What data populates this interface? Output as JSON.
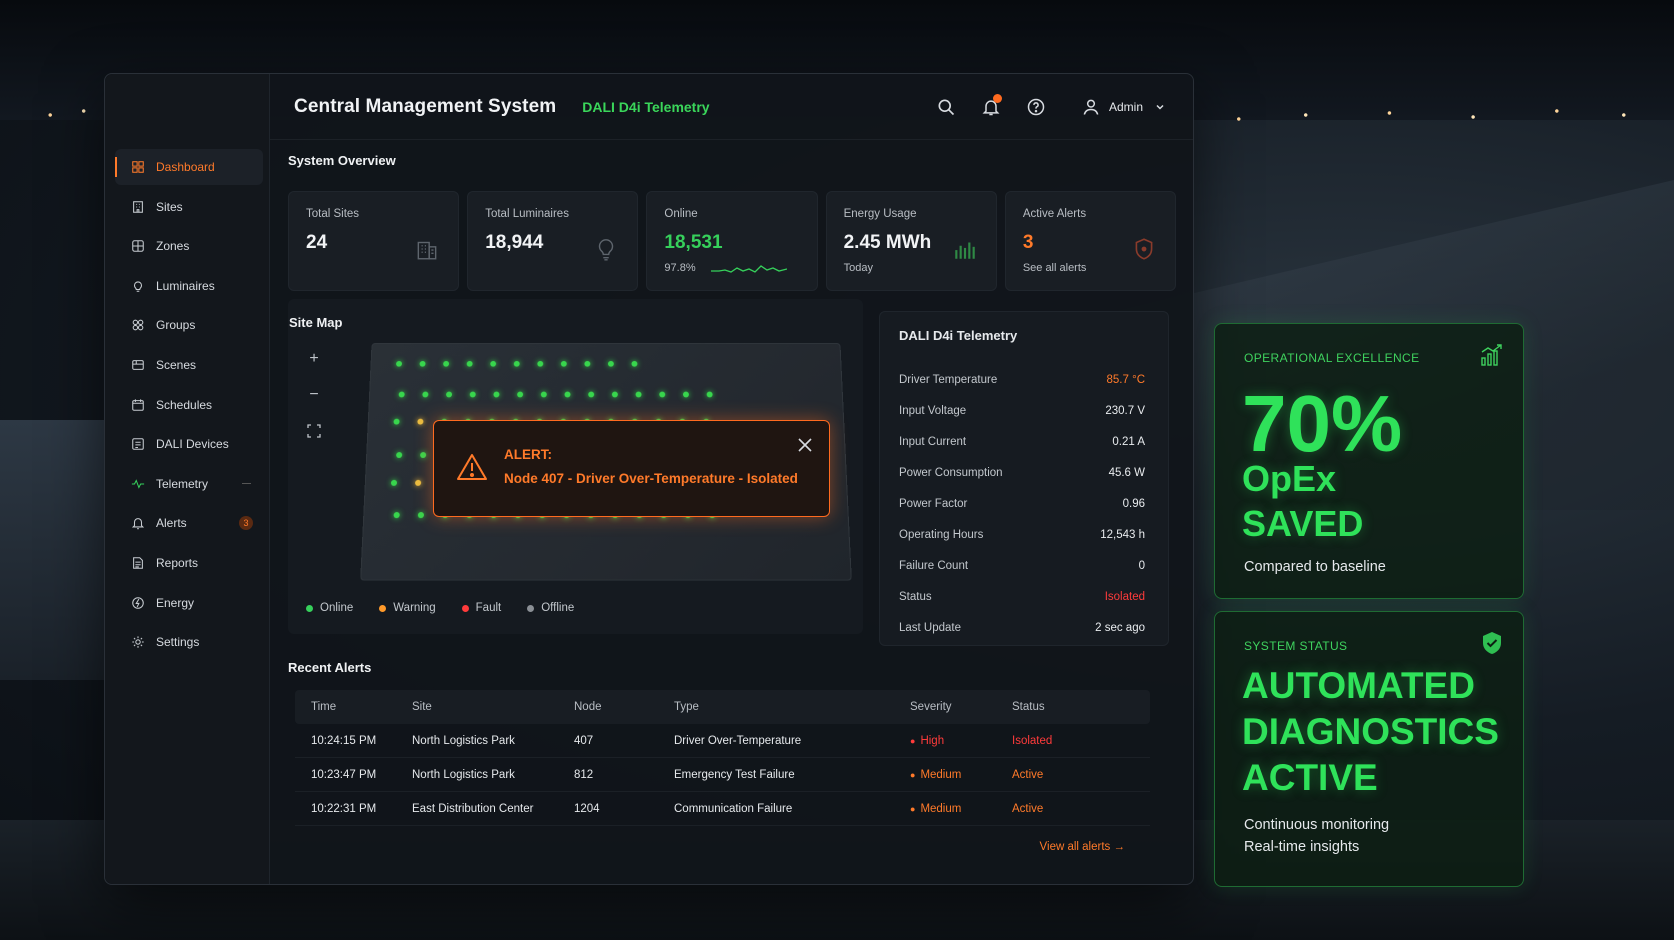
{
  "app": {
    "title": "Central Management System",
    "subtitle": "DALI D4i Telemetry"
  },
  "topbar": {
    "user": "Admin",
    "notifications": 1
  },
  "sidebar": {
    "items": [
      {
        "label": "Dashboard",
        "icon": "dashboard-icon",
        "active": true
      },
      {
        "label": "Sites",
        "icon": "building-icon"
      },
      {
        "label": "Zones",
        "icon": "zones-icon"
      },
      {
        "label": "Luminaires",
        "icon": "bulb-icon"
      },
      {
        "label": "Groups",
        "icon": "groups-icon"
      },
      {
        "label": "Scenes",
        "icon": "scenes-icon"
      },
      {
        "label": "Schedules",
        "icon": "calendar-icon"
      },
      {
        "label": "DALI Devices",
        "icon": "device-icon"
      },
      {
        "label": "Telemetry",
        "icon": "pulse-icon"
      },
      {
        "label": "Alerts",
        "icon": "bell-icon",
        "badge": "3"
      },
      {
        "label": "Reports",
        "icon": "report-icon"
      },
      {
        "label": "Energy",
        "icon": "energy-icon"
      },
      {
        "label": "Settings",
        "icon": "gear-icon"
      }
    ]
  },
  "overview": {
    "title": "System Overview",
    "cards": [
      {
        "label": "Total Sites",
        "value": "24",
        "sub": ""
      },
      {
        "label": "Total Luminaires",
        "value": "18,944",
        "sub": ""
      },
      {
        "label": "Online",
        "value": "18,531",
        "sub": "97.8%"
      },
      {
        "label": "Energy Usage",
        "value": "2.45 MWh",
        "sub": "Today"
      },
      {
        "label": "Active Alerts",
        "value": "3",
        "sub": "See all alerts"
      }
    ]
  },
  "site_map": {
    "title": "Site Map",
    "legend": [
      "Online",
      "Warning",
      "Fault",
      "Offline"
    ],
    "legend_colors": [
      "#36d05b",
      "#ff9a2a",
      "#ff3b3b",
      "#8a8f95"
    ]
  },
  "alert_popup": {
    "title": "ALERT:",
    "message": "Node 407 - Driver Over-Temperature - Isolated"
  },
  "telemetry": {
    "title": "DALI D4i Telemetry",
    "rows": [
      {
        "label": "Driver Temperature",
        "value": "85.7 °C",
        "tone": "orange"
      },
      {
        "label": "Input Voltage",
        "value": "230.7 V"
      },
      {
        "label": "Input Current",
        "value": "0.21 A"
      },
      {
        "label": "Power Consumption",
        "value": "45.6 W"
      },
      {
        "label": "Power Factor",
        "value": "0.96"
      },
      {
        "label": "Operating Hours",
        "value": "12,543 h"
      },
      {
        "label": "Failure Count",
        "value": "0"
      },
      {
        "label": "Status",
        "value": "Isolated",
        "tone": "red"
      },
      {
        "label": "Last Update",
        "value": "2 sec ago"
      }
    ]
  },
  "recent_alerts": {
    "title": "Recent Alerts",
    "columns": [
      "Time",
      "Site",
      "Node",
      "Type",
      "Severity",
      "Status"
    ],
    "rows": [
      {
        "time": "10:24:15 PM",
        "site": "North Logistics Park",
        "node": "407",
        "type": "Driver Over-Temperature",
        "severity": "High",
        "status": "Isolated"
      },
      {
        "time": "10:23:47 PM",
        "site": "North Logistics Park",
        "node": "812",
        "type": "Emergency Test Failure",
        "severity": "Medium",
        "status": "Active"
      },
      {
        "time": "10:22:31 PM",
        "site": "East Distribution Center",
        "node": "1204",
        "type": "Communication Failure",
        "severity": "Medium",
        "status": "Active"
      }
    ],
    "view_all": "View all alerts"
  },
  "promo_opex": {
    "tag": "OPERATIONAL EXCELLENCE",
    "value": "70%",
    "line1": "OpEx",
    "line2": "SAVED",
    "note": "Compared to baseline"
  },
  "promo_status": {
    "tag": "SYSTEM STATUS",
    "line1": "AUTOMATED",
    "line2": "DIAGNOSTICS",
    "line3": "ACTIVE",
    "note1": "Continuous monitoring",
    "note2": "Real-time insights"
  },
  "colors": {
    "accent_orange": "#ff7a2a",
    "accent_green": "#36d05b",
    "danger": "#ff3b3b"
  }
}
